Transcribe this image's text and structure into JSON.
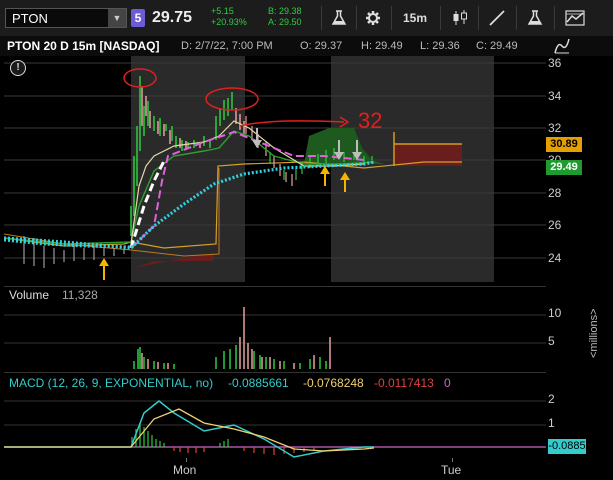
{
  "toolbar": {
    "symbol": "PTON",
    "link_badge": "5",
    "last_price": "29.75",
    "change_abs": "+5.15",
    "change_pct": "+20.93%",
    "bid": "B: 29.38",
    "ask": "A: 29.50",
    "timeframe": "15m",
    "icons": [
      "flask-icon",
      "gear-icon",
      "candlestick-icon",
      "drawing-line-icon",
      "flask-icon",
      "pattern-icon"
    ]
  },
  "header": {
    "title": "PTON 20 D 15m [NASDAQ]",
    "date": "D: 2/7/22, 7:00 PM",
    "open": "O: 29.37",
    "high": "H: 29.49",
    "low": "L: 29.36",
    "close": "C: 29.49"
  },
  "price_axis": {
    "ticks": [
      "36",
      "34",
      "32",
      "30",
      "28",
      "26",
      "24"
    ],
    "tag_upper": "30.89",
    "tag_last": "29.49",
    "colors": {
      "tag_upper_bg": "#e5a000",
      "tag_last_bg": "#1f9a2e"
    }
  },
  "annotation": {
    "text": "32",
    "color": "#e02020"
  },
  "volume": {
    "name": "Volume",
    "value": "11,328",
    "ticks": [
      "10",
      "5"
    ],
    "unit": "<millions>"
  },
  "macd": {
    "name": "MACD (12, 26, 9, EXPONENTIAL, no)",
    "value": "-0.0885661",
    "avg": "-0.0768248",
    "diff": "-0.0117413",
    "zero": "0",
    "ticks": [
      "2",
      "1"
    ],
    "tag": "-0.0885",
    "colors": {
      "value": "#33cccc",
      "avg": "#f0d070",
      "diff": "#e04040",
      "zero": "#cc66cc"
    }
  },
  "time_axis": {
    "labels": [
      "Mon",
      "Tue"
    ]
  }
}
